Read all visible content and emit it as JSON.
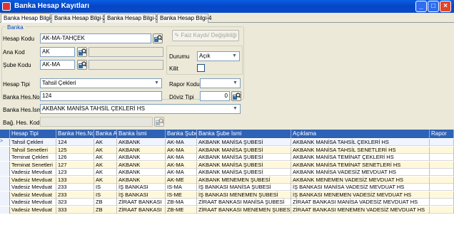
{
  "window": {
    "title": "Banka Hesap Kayıtları",
    "minimize": "_",
    "maximize": "□",
    "close": "×"
  },
  "tabs": [
    {
      "label": "Banka Hesap Bilgi-1"
    },
    {
      "label": "Banka Hesap Bilgi-2"
    },
    {
      "label": "Banka Hesap Bilgi-3"
    },
    {
      "label": "Banka Hesap Bilgi-4"
    }
  ],
  "form": {
    "group_title": "Banka",
    "hesap_kodu": {
      "label": "Hesap Kodu",
      "value": "AK-MA-TAHÇEK"
    },
    "ana_kod": {
      "label": "Ana Kod",
      "value": "AK",
      "desc": ""
    },
    "sube_kodu": {
      "label": "Şube Kodu",
      "value": "AK-MA",
      "desc": ""
    },
    "faiz_button": "Faiz Kaydı/ Değişikliği",
    "durumu": {
      "label": "Durumu",
      "value": "Açık"
    },
    "kilit": {
      "label": "Kilit"
    },
    "hesap_tipi": {
      "label": "Hesap Tipi",
      "value": "Tahsil Çekleri"
    },
    "rapor_kodu": {
      "label": "Rapor Kodu",
      "value": ""
    },
    "banka_hes_no": {
      "label": "Banka Hes.No",
      "value": "124"
    },
    "doviz_tipi": {
      "label": "Döviz Tipi",
      "value": "0"
    },
    "banka_hes_ismi": {
      "label": "Banka Hes.İsmi",
      "value": "AKBANK MANİSA TAHSİL ÇEKLERİ HS"
    },
    "bag_hes_kod": {
      "label": "Bağ. Hes. Kod",
      "value": ""
    }
  },
  "grid": {
    "columns": [
      "Hesap Tipi",
      "Banka Hes.No",
      "Banka Ar",
      "Banka İsmi",
      "Banka Şube",
      "Banka Şube İsmi",
      "Açıklama",
      "Rapor"
    ],
    "current_row_marker": ">",
    "rows": [
      [
        "Tahsil Çekleri",
        "124",
        "AK",
        "AKBANK",
        "AK-MA",
        "AKBANK MANİSA ŞUBESİ",
        "AKBANK MANİSA TAHSİL ÇEKLERİ HS",
        ""
      ],
      [
        "Tahsil Senetleri",
        "125",
        "AK",
        "AKBANK",
        "AK-MA",
        "AKBANK MANİSA ŞUBESİ",
        "AKBANK MANİSA TAHSİL SENETLERİ HS",
        ""
      ],
      [
        "Teminat Çekleri",
        "126",
        "AK",
        "AKBANK",
        "AK-MA",
        "AKBANK MANİSA ŞUBESİ",
        "AKBANK MANİSA TEMİNAT ÇEKLERİ HS",
        ""
      ],
      [
        "Teminat Senetleri",
        "127",
        "AK",
        "AKBANK",
        "AK-MA",
        "AKBANK MANİSA ŞUBESİ",
        "AKBANK MANİSA TEMİNAT SENETLERİ HS",
        ""
      ],
      [
        "Vadesiz Mevduat",
        "123",
        "AK",
        "AKBANK",
        "AK-MA",
        "AKBANK MANİSA ŞUBESİ",
        "AKBANK MANİSA VADESİZ MEVDUAT HS",
        ""
      ],
      [
        "Vadesiz Mevduat",
        "133",
        "AK",
        "AKBANK",
        "AK-ME",
        "AKBANK MENEMEN ŞUBESİ",
        "AKBANK MENEMEN VADESİZ MEVDUAT HS",
        ""
      ],
      [
        "Vadesiz Mevduat",
        "233",
        "IS",
        "İŞ BANKASI",
        "IS-MA",
        "İŞ BANKASI MANİSA ŞUBESİ",
        "İŞ BANKASI MANİSA VADESİZ MEVDUAT HS",
        ""
      ],
      [
        "Vadesiz Mevduat",
        "233",
        "IS",
        "İŞ BANKASI",
        "IS-ME",
        "İŞ BANKASI MENEMEN ŞUBESİ",
        "İŞ BANKASI MENEMEN VADESİZ MEVDUAT HS",
        ""
      ],
      [
        "Vadesiz Mevduat",
        "323",
        "ZB",
        "ZİRAAT BANKASI",
        "ZB-MA",
        "ZİRAAT BANKASI MANİSA ŞUBESİ",
        "ZİRAAT BANKASI MANİSA VADESİZ MEVDUAT HS",
        ""
      ],
      [
        "Vadesiz Mevduat",
        "333",
        "ZB",
        "ZİRAAT BANKASI",
        "ZB-ME",
        "ZİRAAT BANKASI MENEMEN ŞUBESİ",
        "ZİRAAT BANKASI MENEMEN VADESİZ MEVDUAT HS",
        ""
      ]
    ]
  },
  "colors": {
    "titlebar": "#0546C8",
    "grid_header": "#2E62B7",
    "row_even": "#FFF8DA",
    "row_odd": "#FFFFFF",
    "selected_row": "#F0F4FF",
    "group_title": "#0046D5"
  }
}
